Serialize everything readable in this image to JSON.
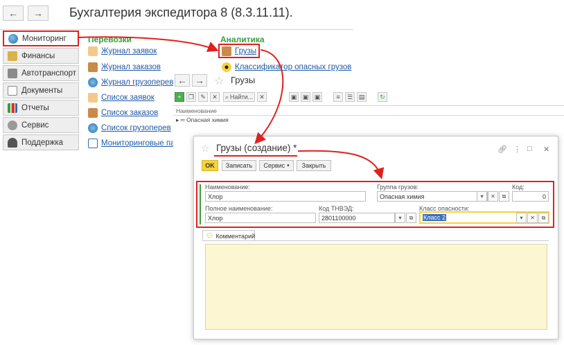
{
  "app": {
    "title": "Бухгалтерия экспедитора 8 (8.3.11.11)."
  },
  "nav": {
    "back": "←",
    "forward": "→"
  },
  "sections": [
    {
      "label": "Мониторинг",
      "icon": "globe-icon",
      "active": true
    },
    {
      "label": "Финансы",
      "icon": "finance-icon"
    },
    {
      "label": "Автотранспорт",
      "icon": "truck-icon"
    },
    {
      "label": "Документы",
      "icon": "document-icon"
    },
    {
      "label": "Отчеты",
      "icon": "chart-icon"
    },
    {
      "label": "Сервис",
      "icon": "gear-icon"
    },
    {
      "label": "Поддержка",
      "icon": "headset-icon"
    }
  ],
  "panel": {
    "transport": {
      "title": "Перевозки",
      "links": [
        "Журнал заявок",
        "Журнал заказов",
        "Журнал грузоперев",
        "Список заявок",
        "Список заказов",
        "Список грузоперев",
        "Мониторинговые па"
      ]
    },
    "analytics": {
      "title": "Аналитика",
      "links": [
        "Грузы",
        "Классификатор опасных грузов"
      ]
    }
  },
  "list_window": {
    "title": "Грузы",
    "find_label": "Найти...",
    "column_header": "Наименование",
    "rows": [
      {
        "name": "Опасная химия"
      }
    ]
  },
  "form": {
    "title": "Грузы (создание) *",
    "buttons": {
      "ok": "OK",
      "save": "Записать",
      "service": "Сервис",
      "close": "Закрыть"
    },
    "fields": {
      "name": {
        "label": "Наименование:",
        "value": "Хлор"
      },
      "group": {
        "label": "Группа грузов:",
        "value": "Опасная химия"
      },
      "code": {
        "label": "Код:",
        "value": "0"
      },
      "full_name": {
        "label": "Полное наименование:",
        "value": "Хлор"
      },
      "tnved": {
        "label": "Код ТНВЭД:",
        "value": "2801100000"
      },
      "danger_class": {
        "label": "Класс опасности:",
        "value": "Класс 2"
      }
    },
    "comment_tab": "Комментарий"
  },
  "colors": {
    "accent_red": "#e0201f",
    "link_blue": "#1f5aa6",
    "group_green": "#3b9b3b",
    "ok_yellow": "#f5d33a",
    "comment_bg": "#fdf6d3"
  }
}
